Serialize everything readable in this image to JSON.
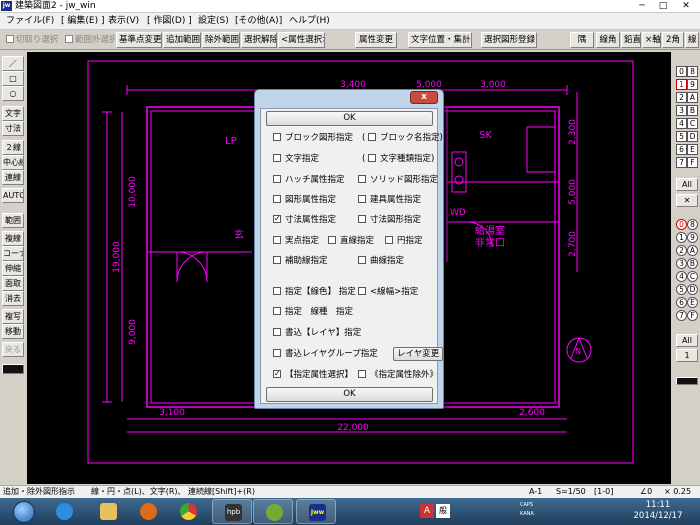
{
  "window": {
    "title": "建築図面2 - jw_win",
    "logo": "jw",
    "controls": [
      "minimize-icon",
      "maximize-icon",
      "close-icon"
    ]
  },
  "menubar": [
    "ファイル(F)",
    "[ 編集(E) ]",
    "表示(V)",
    "[ 作図(D) ]",
    "設定(S)",
    "[その他(A)]",
    "ヘルプ(H)"
  ],
  "toolbar": {
    "cut_select": "切取り選択",
    "out_of_range": "範囲外選択",
    "base_change": "基準点変更",
    "add_range": "追加範囲",
    "exclude_range": "除外範囲",
    "deselect": "選択解除",
    "attr_select": "<属性選択>",
    "attr_change": "属性変更",
    "text_pos": "文字位置・集計",
    "register": "選択図形登録",
    "r1": "隅",
    "r2": "線角",
    "r3": "鉛直",
    "r4": "×軸",
    "r5": "2角",
    "r6": "線"
  },
  "left_tools": [
    "／",
    "□",
    "○",
    "文字",
    "寸法",
    "２線",
    "中心線",
    "連線",
    "AUTO",
    "範囲",
    "複線",
    "コーナー",
    "伸縮",
    "面取",
    "消去",
    "複写",
    "移動",
    "戻る"
  ],
  "right_tools": {
    "group1": [
      [
        "0",
        "8"
      ],
      [
        "1",
        "9"
      ],
      [
        "2",
        "A"
      ],
      [
        "3",
        "B"
      ],
      [
        "4",
        "C"
      ],
      [
        "5",
        "D"
      ],
      [
        "6",
        "E"
      ],
      [
        "7",
        "F"
      ]
    ],
    "all1": "All",
    "x1": "✕",
    "group2": [
      [
        "0",
        "8"
      ],
      [
        "1",
        "9"
      ],
      [
        "2",
        "A"
      ],
      [
        "3",
        "B"
      ],
      [
        "4",
        "C"
      ],
      [
        "5",
        "D"
      ],
      [
        "6",
        "E"
      ],
      [
        "7",
        "F"
      ]
    ],
    "all2": "All",
    "num": "1"
  },
  "drawing": {
    "dims": {
      "top_a": "3,400",
      "top_b": "5,000",
      "top_c": "3,000",
      "left_total": "19,000",
      "left_a": "10,000",
      "left_b": "9,000",
      "right_a": "2,300",
      "right_b": "5,000",
      "right_c": "2,700",
      "bottom_a": "3,100",
      "bottom_b": "2,600",
      "bottom_total": "22,000"
    },
    "rooms": {
      "lp": "LP",
      "sk": "SK",
      "wd": "WD",
      "r1": "給湯室",
      "r2": "非常口",
      "r3": "玄"
    },
    "north": "N"
  },
  "dialog": {
    "close": "x",
    "ok_top": "OK",
    "ok_bottom": "OK",
    "items": {
      "block": "ブロック図形指定",
      "block_name": "ブロック名指定",
      "text": "文字指定",
      "text_kind": "文字種類指定",
      "hatch": "ハッチ属性指定",
      "solid": "ソリッド図形指定",
      "shape_attr": "図形属性指定",
      "fixture": "建具属性指定",
      "dim_attr": "寸法属性指定",
      "dim_shape": "寸法図形指定",
      "point": "実点指定",
      "line": "直線指定",
      "circle": "円指定",
      "aux": "補助線指定",
      "curve": "曲線指定",
      "line_color": "指定【線色】 指定",
      "line_width": "<線幅>指定",
      "line_type": "指定　線種　指定",
      "layer": "書込【レイヤ】指定",
      "layer_group": "書込レイヤグループ指定",
      "layer_change": "レイヤ変更",
      "select_attr": "【指定属性選択】",
      "exclude_attr": "《指定属性除外》"
    },
    "paren_open": "(",
    "paren_close": ")"
  },
  "status": {
    "hint": "追加・除外図形指示　　線・円・点(L)、文字(R)、 連続線[Shift]+(R)",
    "sheet": "A-1",
    "scale": "S=1/50",
    "layer": "[1-0]",
    "angle": "∠0",
    "zoom": "× 0.25"
  },
  "taskbar": {
    "apps": [
      "start-orb",
      "ie-icon",
      "folder-icon",
      "media-icon",
      "chrome-icon",
      "hpb-icon",
      "game-icon",
      "jww-icon"
    ],
    "hpb": "hpb",
    "jww": "Jww",
    "ime_a": "A",
    "ime_b": "般",
    "caps": "CAPS",
    "kana": "KANA",
    "time": "11:11",
    "date": "2014/12/17"
  },
  "colors": {
    "drawing": "#ff00ff",
    "canvas": "#000000"
  }
}
